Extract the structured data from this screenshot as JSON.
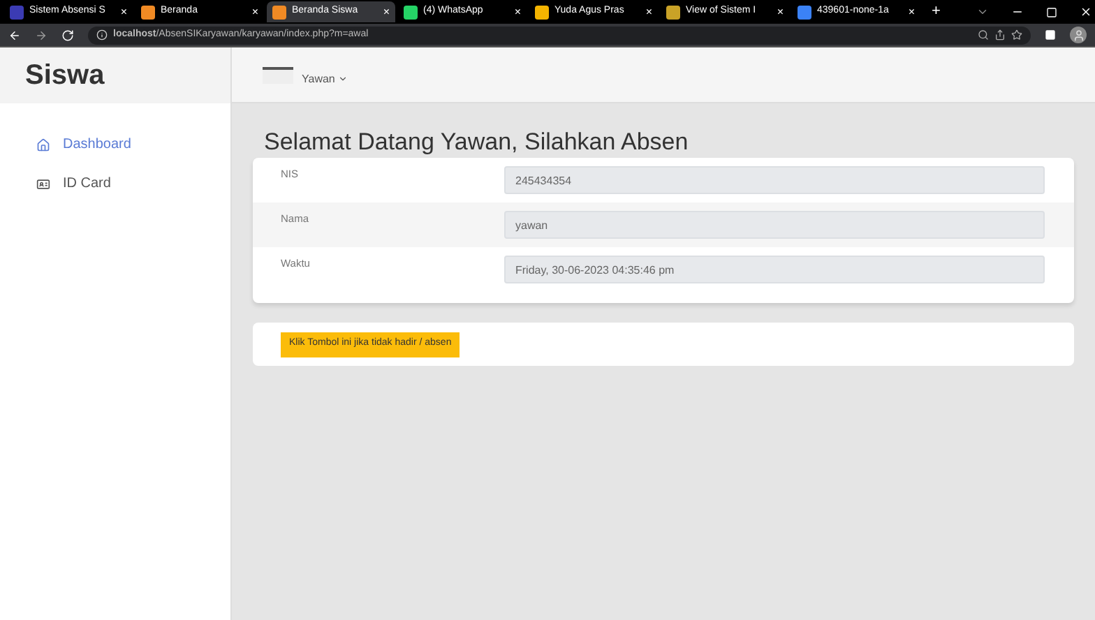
{
  "browser": {
    "tabs": [
      {
        "title": "Sistem Absensi S",
        "close": "×",
        "selected": false
      },
      {
        "title": "Beranda",
        "close": "×",
        "selected": false
      },
      {
        "title": "Beranda Siswa",
        "close": "×",
        "selected": true
      },
      {
        "title": "(4) WhatsApp",
        "close": "×",
        "selected": false
      },
      {
        "title": "Yuda Agus Pras",
        "close": "×",
        "selected": false
      },
      {
        "title": "View of Sistem I",
        "close": "×",
        "selected": false
      },
      {
        "title": "439601-none-1a",
        "close": "×",
        "selected": false
      }
    ],
    "new_tab": "+",
    "url": "**localhost**/AbsenSIKaryawan/karyawan/index.php?m=awal"
  },
  "sidebar": {
    "brand": "Siswa",
    "items": [
      {
        "label": "Dashboard",
        "selected": true,
        "kind": "home"
      },
      {
        "label": "ID Card",
        "selected": false,
        "kind": "card"
      }
    ]
  },
  "topbar": {
    "user": "Yawan"
  },
  "heading": "Selamat Datang Yawan, Silahkan Absen",
  "fields": [
    {
      "label": "NIS",
      "value": "245434354"
    },
    {
      "label": "Nama",
      "value": "yawan"
    },
    {
      "label": "Waktu",
      "value": "Friday, 30-06-2023 04:35:46 pm"
    }
  ],
  "absent_button": "Klik Tombol ini jika tidak hadir / absen"
}
